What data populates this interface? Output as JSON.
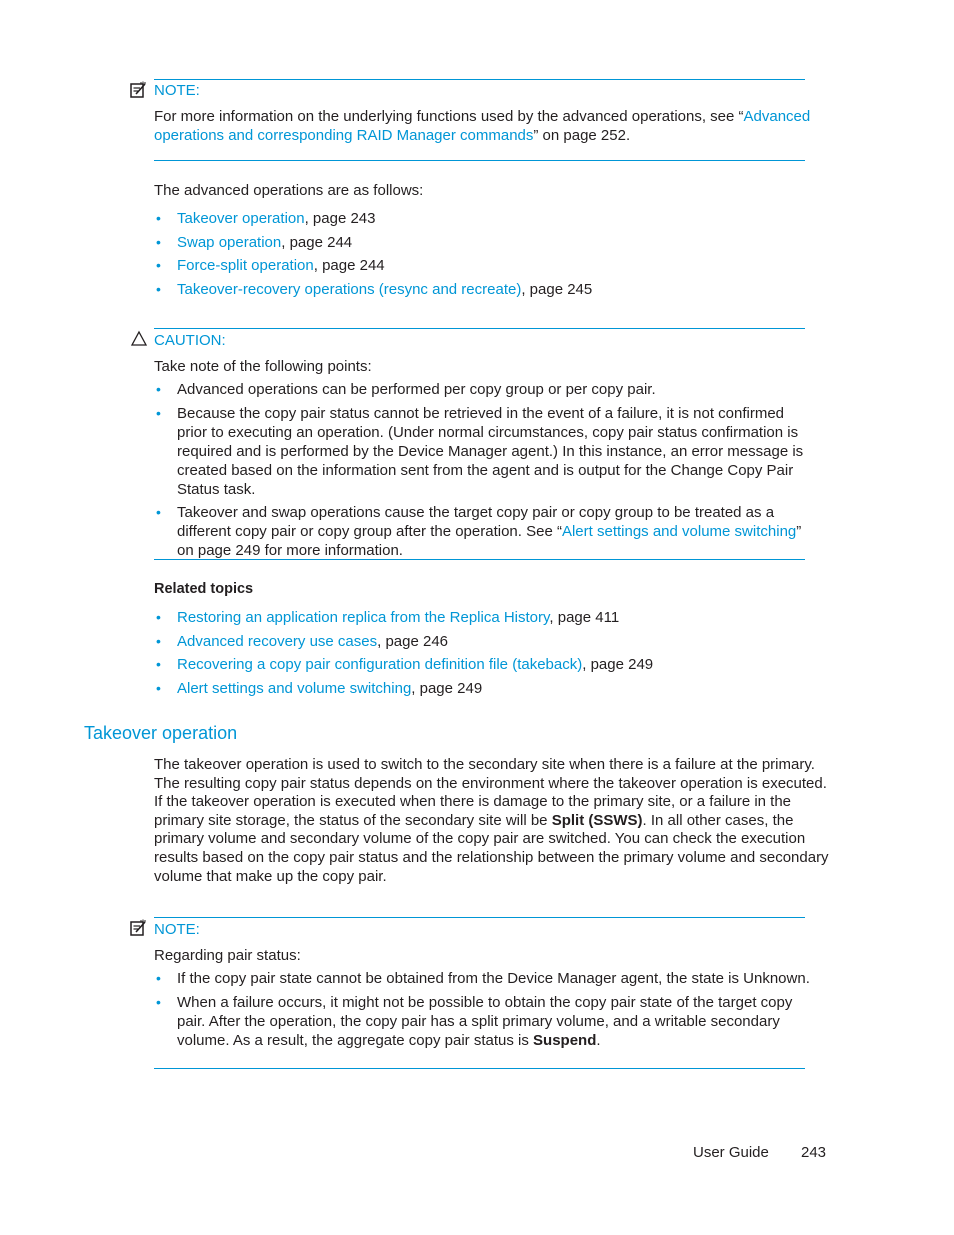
{
  "note1": {
    "title": "NOTE:",
    "text_before": "For more information on the underlying functions used by the advanced operations, see “",
    "link": "Advanced operations and corresponding RAID Manager commands",
    "text_after": "” on page 252."
  },
  "intro": "The advanced operations are as follows:",
  "operations": [
    {
      "link": "Takeover operation",
      "suffix": ", page 243"
    },
    {
      "link": "Swap operation",
      "suffix": ", page 244"
    },
    {
      "link": "Force-split operation",
      "suffix": ", page 244"
    },
    {
      "link": "Takeover-recovery operations (resync and recreate)",
      "suffix": ", page 245"
    }
  ],
  "caution": {
    "title": "CAUTION:",
    "lead": "Take note of the following points:",
    "items": [
      "Advanced operations can be performed per copy group or per copy pair.",
      "Because the copy pair status cannot be retrieved in the event of a failure, it is not confirmed prior to executing an operation. (Under normal circumstances, copy pair status confirmation is required and is performed by the Device Manager agent.) In this instance, an error message is created based on the information sent from the agent and is output for the Change Copy Pair Status task."
    ],
    "item3": {
      "before": "Takeover and swap operations cause the target copy pair or copy group to be treated as a different copy pair or copy group after the operation. See “",
      "link": "Alert settings and volume switching",
      "after": "” on page 249 for more information."
    }
  },
  "related": {
    "title": "Related topics",
    "items": [
      {
        "link": "Restoring an application replica from the Replica History",
        "suffix": ", page 411"
      },
      {
        "link": "Advanced recovery use cases",
        "suffix": ", page 246"
      },
      {
        "link": "Recovering a copy pair configuration definition file (takeback)",
        "suffix": ", page 249"
      },
      {
        "link": "Alert settings and volume switching",
        "suffix": ", page 249"
      }
    ]
  },
  "section": {
    "heading": "Takeover operation",
    "para_before": "The takeover operation is used to switch to the secondary site when there is a failure at the primary. The resulting copy pair status depends on the environment where the takeover operation is executed. If the takeover operation is executed when there is damage to the primary site, or a failure in the primary site storage, the status of the secondary site will be ",
    "para_bold": "Split (SSWS)",
    "para_after": ". In all other cases, the primary volume and secondary volume of the copy pair are switched. You can check the execution results based on the copy pair status and the relationship between the primary volume and secondary volume that make up the copy pair."
  },
  "note2": {
    "title": "NOTE:",
    "lead": "Regarding pair status:",
    "item1": "If the copy pair state cannot be obtained from the Device Manager agent, the state is Unknown.",
    "item2_before": "When a failure occurs, it might not be possible to obtain the copy pair state of the target copy pair. After the operation, the copy pair has a split primary volume, and a writable secondary volume. As a result, the aggregate copy pair status is ",
    "item2_bold": "Suspend",
    "item2_after": "."
  },
  "footer": {
    "label": "User Guide",
    "page": "243"
  }
}
